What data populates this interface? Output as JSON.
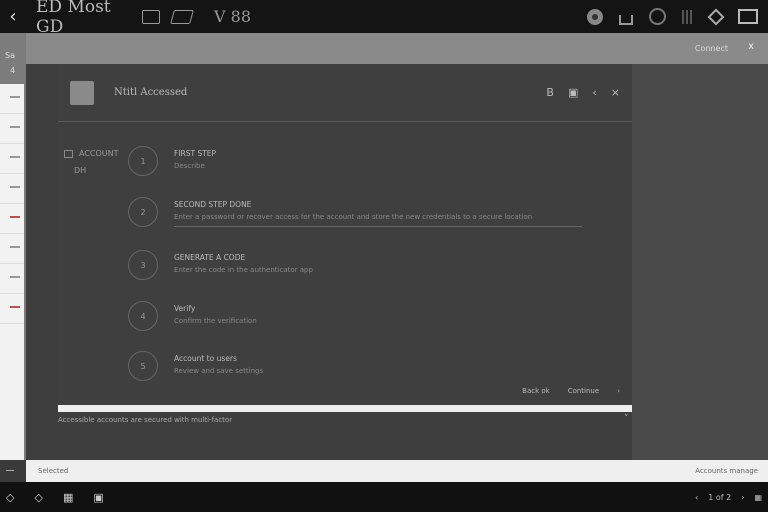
{
  "topbar": {
    "back_glyph": "‹",
    "app_title": "ED Most GD",
    "version": "V 88",
    "icons": [
      "disc-icon",
      "home-icon",
      "at-icon",
      "grid-icon",
      "diamond-icon",
      "frame-icon"
    ]
  },
  "leftstrip": {
    "label1": "Sa",
    "label2": "4"
  },
  "grayband": {
    "status": "Connect",
    "close": "x"
  },
  "dialog": {
    "title": "Ntitl Accessed",
    "header_icons": {
      "a": "B",
      "b": "▣",
      "c": "‹",
      "d": "×"
    },
    "step_col": {
      "label": "ACCOUNT",
      "sub": "DH"
    },
    "steps": [
      {
        "num": "1",
        "title": "FIRST STEP",
        "desc": "Describe"
      },
      {
        "num": "2",
        "title": "SECOND STEP DONE",
        "desc": "Enter a password or recover access for the account and store the new credentials to a secure location"
      },
      {
        "num": "3",
        "title": "GENERATE A CODE",
        "desc": "Enter the code in the authenticator app"
      },
      {
        "num": "4",
        "title": "Verify",
        "desc": "Confirm the verification"
      },
      {
        "num": "5",
        "title": "Account to users",
        "desc": "Review and save settings"
      }
    ],
    "footer": {
      "left": "Back  ok",
      "mid": "Continue",
      "right": "›"
    }
  },
  "below": {
    "text": "Accessible accounts are secured with multi-factor",
    "chevron": "˅"
  },
  "footer_strip": {
    "left": "Selected",
    "right": "Accounts manage"
  },
  "bottombar": {
    "left_icons": [
      "diamond-icon",
      "diamond-icon",
      "grid-icon",
      "frame-icon"
    ],
    "right_text": "1 of 2"
  }
}
